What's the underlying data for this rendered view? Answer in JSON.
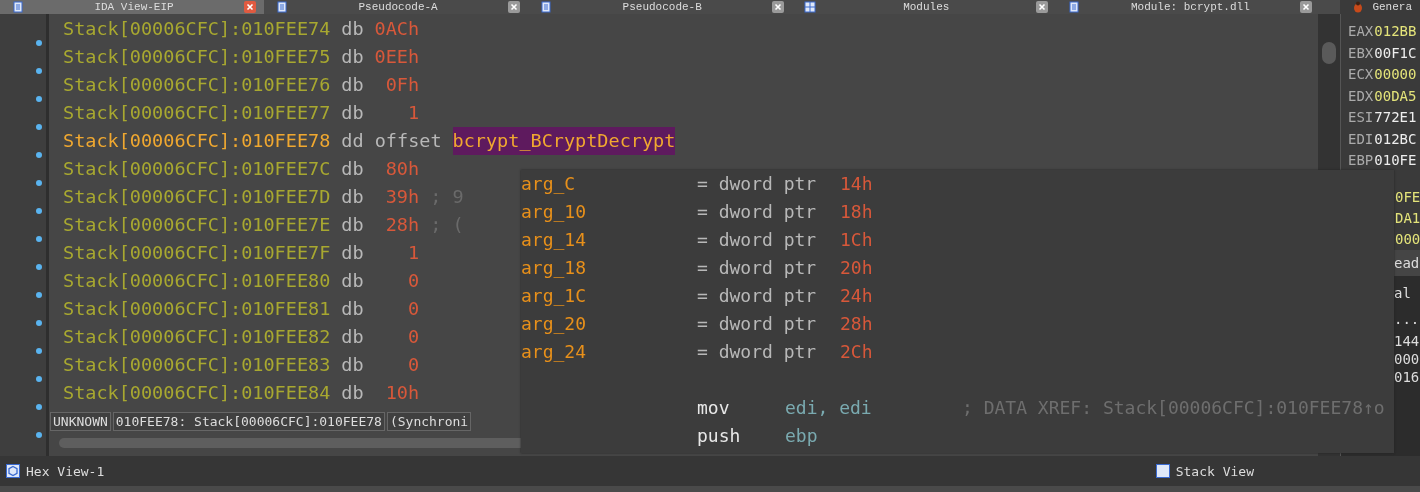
{
  "tabs": [
    {
      "label": "IDA View-EIP",
      "selected": true,
      "kind": "view"
    },
    {
      "label": "Pseudocode-A",
      "selected": false,
      "kind": "view"
    },
    {
      "label": "Pseudocode-B",
      "selected": false,
      "kind": "view"
    },
    {
      "label": "Modules",
      "selected": false,
      "kind": "list"
    },
    {
      "label": "Module: bcrypt.dll",
      "selected": false,
      "kind": "view"
    },
    {
      "label": "Genera",
      "selected": false,
      "kind": "debugger"
    }
  ],
  "lines": [
    {
      "kind": "data",
      "address": "Stack[00006CFC]:010FEE74",
      "directive": "db",
      "value": "0ACh",
      "highlighted": false
    },
    {
      "kind": "data",
      "address": "Stack[00006CFC]:010FEE75",
      "directive": "db",
      "value": "0EEh",
      "highlighted": false
    },
    {
      "kind": "data",
      "address": "Stack[00006CFC]:010FEE76",
      "directive": "db",
      "value": " 0Fh",
      "highlighted": false
    },
    {
      "kind": "data",
      "address": "Stack[00006CFC]:010FEE77",
      "directive": "db",
      "value": "   1",
      "highlighted": false
    },
    {
      "kind": "offset",
      "address": "Stack[00006CFC]:010FEE78",
      "directive": "dd offset",
      "value": "bcrypt_BCryptDecrypt",
      "highlighted": true
    },
    {
      "kind": "data",
      "address": "Stack[00006CFC]:010FEE7C",
      "directive": "db",
      "value": " 80h",
      "highlighted": false
    },
    {
      "kind": "data",
      "address": "Stack[00006CFC]:010FEE7D",
      "directive": "db",
      "value": " 39h",
      "comment": "; 9",
      "highlighted": false
    },
    {
      "kind": "data",
      "address": "Stack[00006CFC]:010FEE7E",
      "directive": "db",
      "value": " 28h",
      "comment": "; (",
      "highlighted": false
    },
    {
      "kind": "data",
      "address": "Stack[00006CFC]:010FEE7F",
      "directive": "db",
      "value": "   1",
      "highlighted": false
    },
    {
      "kind": "data",
      "address": "Stack[00006CFC]:010FEE80",
      "directive": "db",
      "value": "   0",
      "highlighted": false
    },
    {
      "kind": "data",
      "address": "Stack[00006CFC]:010FEE81",
      "directive": "db",
      "value": "   0",
      "highlighted": false
    },
    {
      "kind": "data",
      "address": "Stack[00006CFC]:010FEE82",
      "directive": "db",
      "value": "   0",
      "highlighted": false
    },
    {
      "kind": "data",
      "address": "Stack[00006CFC]:010FEE83",
      "directive": "db",
      "value": "   0",
      "highlighted": false
    },
    {
      "kind": "data",
      "address": "Stack[00006CFC]:010FEE84",
      "directive": "db",
      "value": " 10h",
      "highlighted": false
    }
  ],
  "status": [
    "UNKNOWN",
    "010FEE78: Stack[00006CFC]:010FEE78",
    "(Synchroni"
  ],
  "popup": {
    "args": [
      {
        "name": "arg_C",
        "type": "= dword ptr",
        "value": "14h"
      },
      {
        "name": "arg_10",
        "type": "= dword ptr",
        "value": "18h"
      },
      {
        "name": "arg_14",
        "type": "= dword ptr",
        "value": "1Ch"
      },
      {
        "name": "arg_18",
        "type": "= dword ptr",
        "value": "20h"
      },
      {
        "name": "arg_1C",
        "type": "= dword ptr",
        "value": "24h"
      },
      {
        "name": "arg_20",
        "type": "= dword ptr",
        "value": "28h"
      },
      {
        "name": "arg_24",
        "type": "= dword ptr",
        "value": "2Ch"
      }
    ],
    "instructions": [
      {
        "mnemonic": "mov",
        "operands": "edi, edi",
        "comment": "; DATA XREF: Stack[00006CFC]:010FEE78↑o"
      },
      {
        "mnemonic": "push",
        "operands": "ebp"
      }
    ]
  },
  "registers": [
    {
      "name": "EAX",
      "value": "012BB",
      "changed": true
    },
    {
      "name": "EBX",
      "value": "00F1C",
      "changed": false
    },
    {
      "name": "ECX",
      "value": "00000",
      "changed": true
    },
    {
      "name": "EDX",
      "value": "00DA5",
      "changed": true
    },
    {
      "name": "ESI",
      "value": "772E1",
      "changed": false
    },
    {
      "name": "EDI",
      "value": "012BC",
      "changed": false
    },
    {
      "name": "EBP",
      "value": "010FE",
      "changed": false
    }
  ],
  "register_fragments": [
    {
      "text": "0FE",
      "changed": true
    },
    {
      "text": "DA1",
      "changed": true
    },
    {
      "text": "000",
      "changed": true
    }
  ],
  "side_fragments": [
    "ead",
    "al",
    "...",
    "144",
    "000",
    "016"
  ],
  "bottom": {
    "hex_view": "Hex View-1",
    "stack_view": "Stack View"
  }
}
